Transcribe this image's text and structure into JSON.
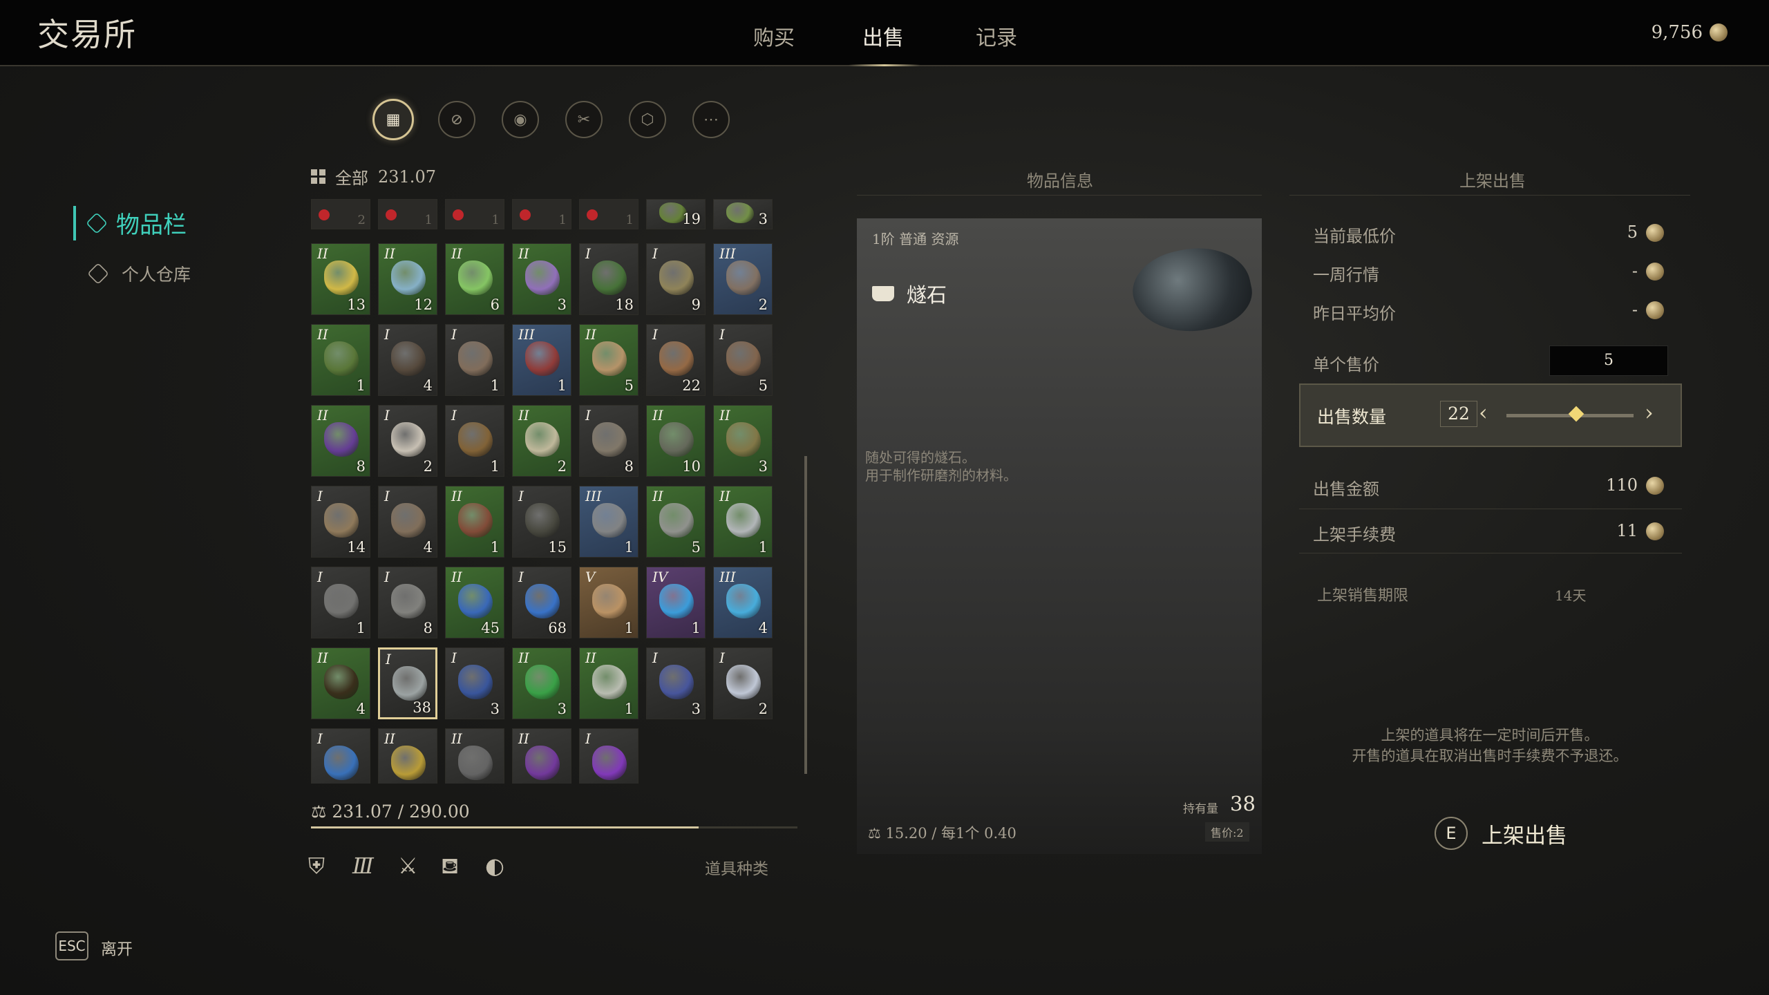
{
  "header": {
    "title": "交易所",
    "tabs": [
      {
        "label": "购买"
      },
      {
        "label": "出售"
      },
      {
        "label": "记录"
      }
    ],
    "active_tab": "出售",
    "currency": "9,756",
    "currency_icon": "coin-icon"
  },
  "nav": {
    "inventory": "物品栏",
    "warehouse": "个人仓库"
  },
  "filters": [
    {
      "name": "all-filter",
      "glyph": "▦"
    },
    {
      "name": "equipment-filter",
      "glyph": "⊘"
    },
    {
      "name": "material-filter",
      "glyph": "◉"
    },
    {
      "name": "tool-filter",
      "glyph": "✂"
    },
    {
      "name": "box-filter",
      "glyph": "⬡"
    },
    {
      "name": "more-filter",
      "glyph": "⋯"
    }
  ],
  "category": {
    "label": "全部",
    "weight": "231.07"
  },
  "locked_row": [
    {
      "count": "2"
    },
    {
      "count": "1"
    },
    {
      "count": "1"
    },
    {
      "count": "1"
    },
    {
      "count": "1"
    }
  ],
  "grid": [
    {
      "tier": "",
      "count": "19",
      "color": "gray",
      "blob": "#6b8a3a"
    },
    {
      "tier": "",
      "count": "3",
      "color": "gray",
      "blob": "#7a9a4a"
    },
    {
      "tier": "II",
      "count": "13",
      "color": "green",
      "blob": "#e2c34a"
    },
    {
      "tier": "II",
      "count": "12",
      "color": "green",
      "blob": "#8fbad8"
    },
    {
      "tier": "II",
      "count": "6",
      "color": "green",
      "blob": "#8ed16a"
    },
    {
      "tier": "II",
      "count": "3",
      "color": "green",
      "blob": "#9b72c9"
    },
    {
      "tier": "I",
      "count": "18",
      "color": "gray",
      "blob": "#4a7a3a"
    },
    {
      "tier": "I",
      "count": "9",
      "color": "gray",
      "blob": "#9a8d5e"
    },
    {
      "tier": "III",
      "count": "2",
      "color": "blue",
      "blob": "#8a7562"
    },
    {
      "tier": "II",
      "count": "1",
      "color": "green",
      "blob": "#5e7a3a"
    },
    {
      "tier": "I",
      "count": "4",
      "color": "gray",
      "blob": "#5a4c3e"
    },
    {
      "tier": "I",
      "count": "1",
      "color": "gray",
      "blob": "#8a7460"
    },
    {
      "tier": "III",
      "count": "1",
      "color": "blue",
      "blob": "#9a3a34"
    },
    {
      "tier": "II",
      "count": "5",
      "color": "green",
      "blob": "#c49a70"
    },
    {
      "tier": "I",
      "count": "22",
      "color": "gray",
      "blob": "#a07048"
    },
    {
      "tier": "I",
      "count": "5",
      "color": "gray",
      "blob": "#8a6a50"
    },
    {
      "tier": "II",
      "count": "8",
      "color": "green",
      "blob": "#6a3aa0"
    },
    {
      "tier": "I",
      "count": "2",
      "color": "gray",
      "blob": "#d8d0c2"
    },
    {
      "tier": "I",
      "count": "1",
      "color": "gray",
      "blob": "#8a6838"
    },
    {
      "tier": "II",
      "count": "2",
      "color": "green",
      "blob": "#cfc3a8"
    },
    {
      "tier": "I",
      "count": "8",
      "color": "gray",
      "blob": "#8a8070"
    },
    {
      "tier": "II",
      "count": "10",
      "color": "green",
      "blob": "#6a6a60"
    },
    {
      "tier": "II",
      "count": "3",
      "color": "green",
      "blob": "#8a7a4a"
    },
    {
      "tier": "I",
      "count": "14",
      "color": "gray",
      "blob": "#9a8260"
    },
    {
      "tier": "I",
      "count": "4",
      "color": "gray",
      "blob": "#8a7660"
    },
    {
      "tier": "II",
      "count": "1",
      "color": "green",
      "blob": "#8a4a3a"
    },
    {
      "tier": "I",
      "count": "15",
      "color": "gray",
      "blob": "#4a4a40"
    },
    {
      "tier": "III",
      "count": "1",
      "color": "blue",
      "blob": "#8a8a88"
    },
    {
      "tier": "II",
      "count": "5",
      "color": "green",
      "blob": "#9a9898"
    },
    {
      "tier": "II",
      "count": "1",
      "color": "green",
      "blob": "#c0c0c8"
    },
    {
      "tier": "I",
      "count": "1",
      "color": "gray",
      "blob": "#7a7a78"
    },
    {
      "tier": "I",
      "count": "8",
      "color": "gray",
      "blob": "#8a8a86"
    },
    {
      "tier": "II",
      "count": "45",
      "color": "green",
      "blob": "#3a6ac8"
    },
    {
      "tier": "I",
      "count": "68",
      "color": "gray",
      "blob": "#3a7ad8"
    },
    {
      "tier": "V",
      "count": "1",
      "color": "gold",
      "blob": "#c49a6a"
    },
    {
      "tier": "IV",
      "count": "1",
      "color": "purple",
      "blob": "#3aa8e8"
    },
    {
      "tier": "III",
      "count": "4",
      "color": "blue",
      "blob": "#4ab8e8"
    },
    {
      "tier": "II",
      "count": "4",
      "color": "green",
      "blob": "#3a2a1a"
    },
    {
      "tier": "I",
      "count": "38",
      "color": "gray",
      "blob": "#a8b0b0",
      "selected": true
    },
    {
      "tier": "I",
      "count": "3",
      "color": "gray",
      "blob": "#3a5aa8"
    },
    {
      "tier": "II",
      "count": "3",
      "color": "green",
      "blob": "#3aa84a"
    },
    {
      "tier": "II",
      "count": "1",
      "color": "green",
      "blob": "#c8c8c0"
    },
    {
      "tier": "I",
      "count": "3",
      "color": "gray",
      "blob": "#4a5aa8"
    },
    {
      "tier": "I",
      "count": "2",
      "color": "gray",
      "blob": "#d0d8e8"
    },
    {
      "tier": "I",
      "count": "",
      "color": "gray",
      "blob": "#3a78c8"
    },
    {
      "tier": "II",
      "count": "",
      "color": "gray",
      "blob": "#c8a838"
    },
    {
      "tier": "II",
      "count": "",
      "color": "gray",
      "blob": "#6a6a6a"
    },
    {
      "tier": "II",
      "count": "",
      "color": "gray",
      "blob": "#7a3aa8"
    },
    {
      "tier": "I",
      "count": "",
      "color": "gray",
      "blob": "#8a3ac8"
    }
  ],
  "weight": {
    "text": "231.07 / 290.00",
    "fraction": 0.797
  },
  "bottom_filters": [
    "armor-icon",
    "bars-icon",
    "crossed-swords-icon",
    "bag-icon",
    "moon-icon"
  ],
  "bottom_type_label": "道具种类",
  "esc": {
    "key": "ESC",
    "label": "离开"
  },
  "item_info": {
    "section_title": "物品信息",
    "tags": "1阶  普通  资源",
    "name": "燧石",
    "desc1": "随处可得的燧石。",
    "desc2": "用于制作研磨剂的材料。",
    "held_label": "持有量",
    "held_value": "38",
    "price_tag": "售价:2",
    "weight_info": "15.20 / 每1个 0.40"
  },
  "sell": {
    "section_title": "上架出售",
    "lowest_label": "当前最低价",
    "lowest_value": "5",
    "week_label": "一周行情",
    "week_value": "-",
    "yesterday_label": "昨日平均价",
    "yesterday_value": "-",
    "unit_label": "单个售价",
    "unit_value": "5",
    "qty_label": "出售数量",
    "qty_value": "22",
    "qty_fraction": 0.55,
    "total_label": "出售金额",
    "total_value": "110",
    "fee_label": "上架手续费",
    "fee_value": "11",
    "period_label": "上架销售期限",
    "period_value": "14天",
    "note1": "上架的道具将在一定时间后开售。",
    "note2": "开售的道具在取消出售时手续费不予退还。",
    "button_key": "E",
    "button_label": "上架出售"
  }
}
